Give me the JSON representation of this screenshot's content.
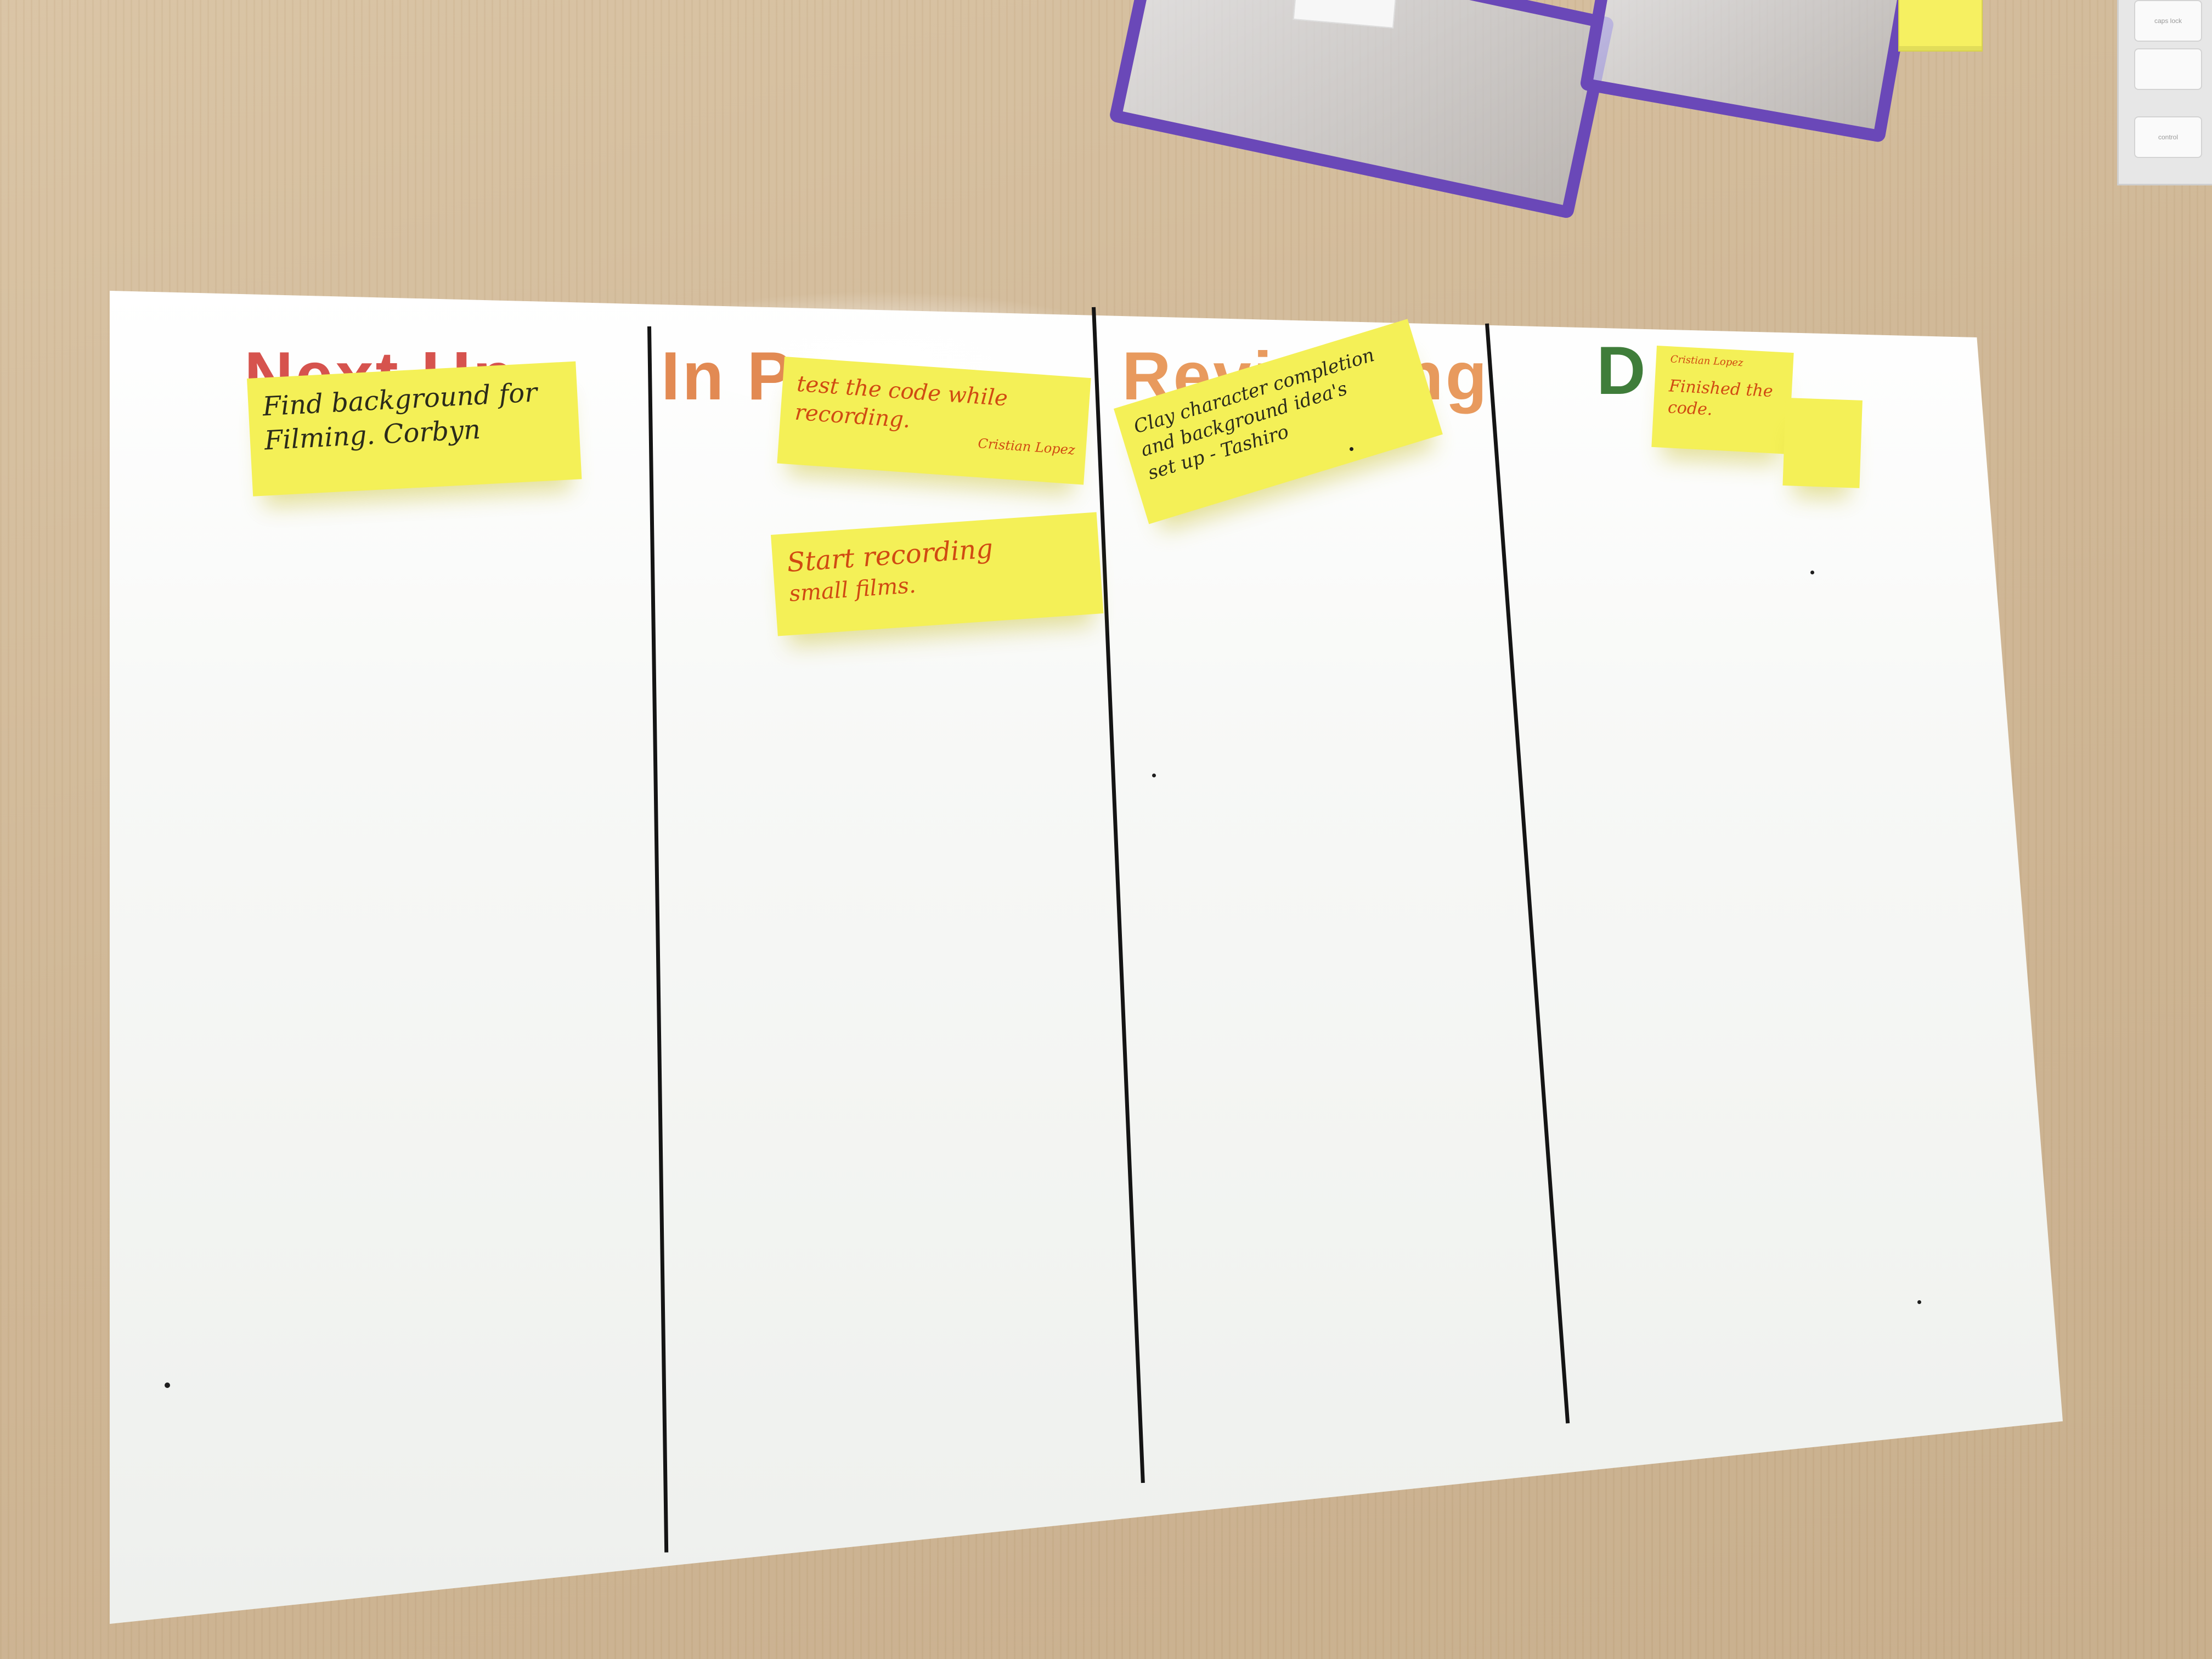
{
  "board": {
    "columns": [
      {
        "title": "Next Up",
        "color": "#d6534e"
      },
      {
        "title": "In P",
        "color": "#e28a53"
      },
      {
        "title": "Revi",
        "suffix": "ng",
        "color": "#e89a5e"
      },
      {
        "title": "D",
        "color": "#3f7d3a"
      }
    ]
  },
  "notes": [
    {
      "lines": [
        "Find background for",
        "Filming.  Corbyn"
      ]
    },
    {
      "lines": [
        "test the code while",
        "recording."
      ],
      "author": "Cristian Lopez"
    },
    {
      "lines": [
        "Start recording",
        "small films."
      ]
    },
    {
      "lines": [
        "Clay character completion",
        "and background idea's",
        "set up  - Tashiro"
      ]
    },
    {
      "lines": [
        "Finished the",
        "code."
      ],
      "author": "Cristian Lopez"
    }
  ],
  "desk": {
    "keyboard_keys": [
      "caps lock",
      "control"
    ]
  }
}
